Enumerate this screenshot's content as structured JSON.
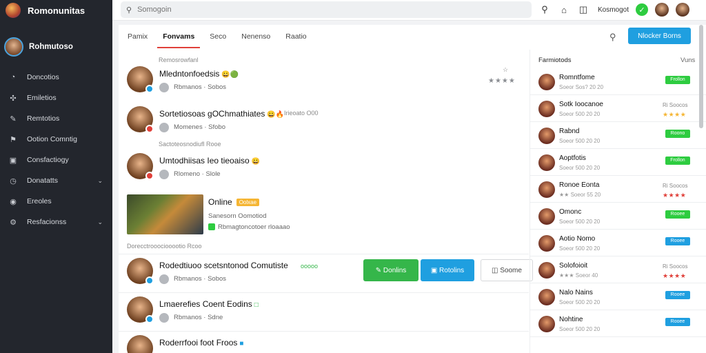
{
  "app": {
    "name": "Romonunitas"
  },
  "profile": {
    "name": "Rohmutoso"
  },
  "sidebar": {
    "items": [
      {
        "label": "Doncotios",
        "icon": "user-icon",
        "glyph": "◔"
      },
      {
        "label": "Emiletios",
        "icon": "puzzle-icon",
        "glyph": "✣"
      },
      {
        "label": "Remtotios",
        "icon": "brush-icon",
        "glyph": "✎"
      },
      {
        "label": "Ootion Comntig",
        "icon": "flag-icon",
        "glyph": "⚑"
      },
      {
        "label": "Consfactiogy",
        "icon": "screen-icon",
        "glyph": "▣"
      },
      {
        "label": "Donatatts",
        "icon": "clock-icon",
        "glyph": "◷",
        "chevron": "⌄"
      },
      {
        "label": "Ereoles",
        "icon": "disc-icon",
        "glyph": "◉"
      },
      {
        "label": "Resfacionss",
        "icon": "gear-icon",
        "glyph": "⚙",
        "chevron": "⌄"
      }
    ]
  },
  "topbar": {
    "search_placeholder": "Somogoin",
    "user": "Kosmogot"
  },
  "tabs": [
    "Pamix",
    "Fonvams",
    "Seco",
    "Nenenso",
    "Raatio"
  ],
  "primary_button": "Nlocker Borns",
  "feed": {
    "header": "Remosrowfanl",
    "posts": [
      {
        "title": "Mledntonfoedsis",
        "meta": "Rbmanos · Sobos",
        "side": "☆",
        "stars": "★★★★"
      },
      {
        "title": "Sortetiosoas gOChmathiates",
        "meta": "Momenes · Sfobo",
        "side": "Irieoato O00"
      },
      {
        "title": "Umtodhiisas Ieo tieoaiso",
        "meta": "Rlomeno · Slole"
      },
      {
        "title": "Rodedtiuoo scetsntonod Comutiste",
        "meta": "Rbmanos · Sobos",
        "side": "ooooo"
      },
      {
        "title": "Lmaerefies Coent Eodins",
        "meta": "Rbmanos · Sdne"
      },
      {
        "title": "Roderrfooi foot Froos",
        "meta": ""
      }
    ],
    "section2": "Sactoteosnodiufl Rooe",
    "game": {
      "title": "Online",
      "badge": "Oolxae",
      "line1": "Sanesorn Oomotiod",
      "line2": "Rbmagtoncotoer rloaaao"
    },
    "section3": "Dorecctrooociooootio Rcoo"
  },
  "actions": {
    "green": "Donlins",
    "blue": "Rotolins",
    "outline": "Soome"
  },
  "panel": {
    "header": "Farmiotods",
    "link": "Vuns",
    "rows": [
      {
        "title": "Romntfome",
        "sub": "Soeor Sos? 20 20",
        "tag": "Frollon",
        "tag_color": "#2ecc40"
      },
      {
        "title": "Sotk Ioocanoe",
        "sub": "Soeor 500 20 20",
        "right": "Ri Soocos",
        "stars": "★★★★",
        "stars_color": "#f5b533"
      },
      {
        "title": "Rabnd",
        "sub": "Soeor 500 20 20",
        "tag": "Roono",
        "tag_color": "#2ecc40"
      },
      {
        "title": "Aoptfotis",
        "sub": "Soeor 500 20 20",
        "tag": "Frollon",
        "tag_color": "#2ecc40"
      },
      {
        "title": "Ronoe Eonta",
        "sub": "★★ Soeor 55 20",
        "right": "Ri Soocos",
        "stars": "★★★★",
        "stars_color": "#e0403a"
      },
      {
        "title": "Omonc",
        "sub": "Soeor 500 20 20",
        "tag": "Rooee",
        "tag_color": "#2ecc40"
      },
      {
        "title": "Aotio Nomo",
        "sub": "Soeor 500 20 20",
        "tag": "Rooee",
        "tag_color": "#1f9fe0"
      },
      {
        "title": "Solofoioit",
        "sub": "★★★ Soeor 40",
        "right": "Ri Soocos",
        "stars": "★★★★",
        "stars_color": "#e0403a"
      },
      {
        "title": "Nalo Nains",
        "sub": "Soeor 500 20 20",
        "tag": "Rooee",
        "tag_color": "#1f9fe0"
      },
      {
        "title": "Nohtine",
        "sub": "Soeor 500 20 20",
        "tag": "Rooee",
        "tag_color": "#1f9fe0"
      }
    ]
  }
}
